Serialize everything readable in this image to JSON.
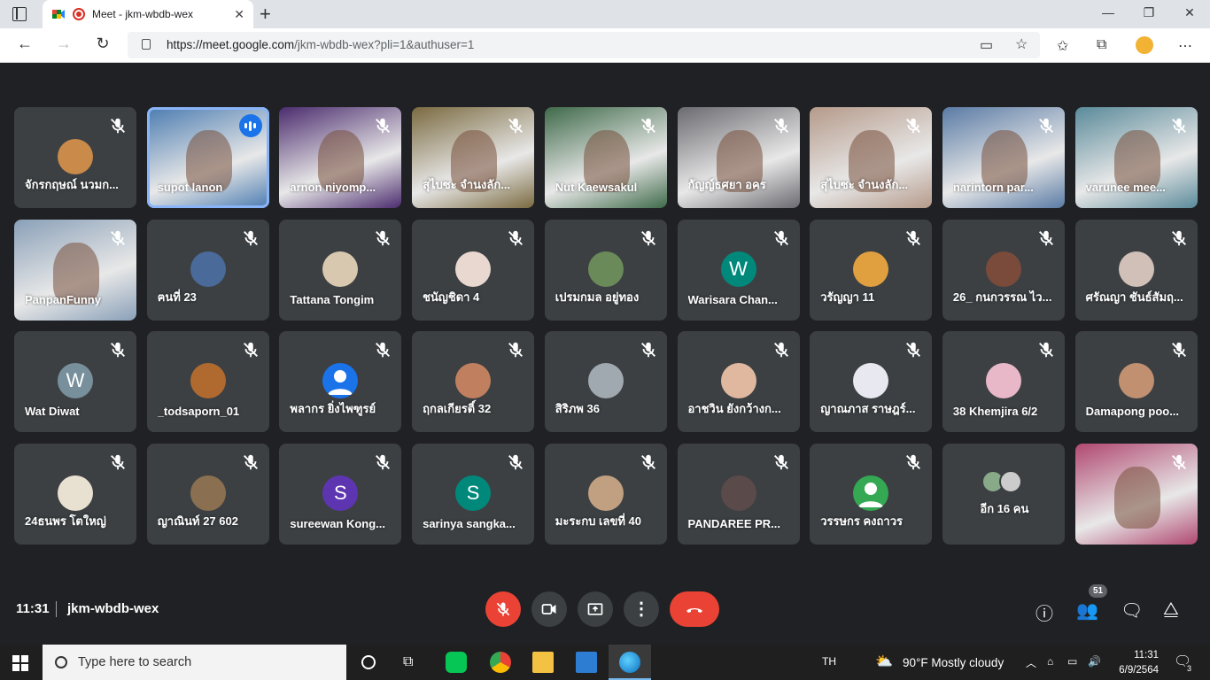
{
  "browser": {
    "tab_title": "Meet - jkm-wbdb-wex",
    "url_host": "https://meet.google.com",
    "url_path": "/jkm-wbdb-wex?pli=1&authuser=1"
  },
  "participants": [
    {
      "name": "จักรกฤษณ์ นวมก...",
      "kind": "avatar",
      "color": "#c98a4a",
      "muted": true
    },
    {
      "name": "supot lanon",
      "kind": "video",
      "color": "#4a7bb0",
      "speaking": true
    },
    {
      "name": "arnon niyomp...",
      "kind": "video",
      "color": "#4b2c6e",
      "muted": true
    },
    {
      "name": "สุไบซะ จำนงลัก...",
      "kind": "video",
      "color": "#7a6a40",
      "muted": true
    },
    {
      "name": "Nut Kaewsakul",
      "kind": "video",
      "color": "#3f6a4a",
      "muted": true
    },
    {
      "name": "กัญญ์ธศยา อคร",
      "kind": "video",
      "color": "#6a6a70",
      "muted": true
    },
    {
      "name": "สุไบซะ จำนงลัก...",
      "kind": "video",
      "color": "#b59a8a",
      "muted": true
    },
    {
      "name": "narintorn par...",
      "kind": "video",
      "color": "#5a7ba5",
      "muted": true
    },
    {
      "name": "varunee mee...",
      "kind": "video",
      "color": "#5a8a9a",
      "muted": true
    },
    {
      "name": "PanpanFunny",
      "kind": "video",
      "color": "#8aa0b8",
      "muted": true
    },
    {
      "name": "ฅนที่ 23",
      "kind": "avatar",
      "color": "#4a6a9a",
      "muted": true
    },
    {
      "name": "Tattana Tongim",
      "kind": "avatar",
      "color": "#d8c8b0",
      "muted": true
    },
    {
      "name": "ชนัญชิดา 4",
      "kind": "avatar",
      "color": "#e8d8d0",
      "muted": true
    },
    {
      "name": "เปรมกมล อยู่ทอง",
      "kind": "avatar",
      "color": "#6a8a5a",
      "muted": true
    },
    {
      "name": "Warisara Chan...",
      "kind": "letter",
      "letter": "W",
      "color": "#00897b",
      "muted": true
    },
    {
      "name": "วรัญญา 11",
      "kind": "avatar",
      "color": "#e0a040",
      "muted": true
    },
    {
      "name": "26_ กนกวรรณ ไว...",
      "kind": "avatar",
      "color": "#7a4a3a",
      "muted": true
    },
    {
      "name": "ศรัณญา ชันธ์สัมฤ...",
      "kind": "avatar",
      "color": "#d0c0b8",
      "muted": true
    },
    {
      "name": "Wat Diwat",
      "kind": "letter",
      "letter": "W",
      "color": "#78909c",
      "muted": true
    },
    {
      "name": "_todsaporn_01",
      "kind": "avatar",
      "color": "#b06a30",
      "muted": true
    },
    {
      "name": "พลากร ยิ่งไพฑูรย์",
      "kind": "person",
      "color": "#1a73e8",
      "muted": true
    },
    {
      "name": "ฤกลเกียรติ์ 32",
      "kind": "avatar",
      "color": "#c08060",
      "muted": true
    },
    {
      "name": "สิริภพ 36",
      "kind": "avatar",
      "color": "#a0a8b0",
      "muted": true
    },
    {
      "name": "อาชวิน ยังกว้างก...",
      "kind": "avatar",
      "color": "#e0b8a0",
      "muted": true
    },
    {
      "name": "ญาณภาส ราษฎร์...",
      "kind": "avatar",
      "color": "#e8e8f0",
      "muted": true
    },
    {
      "name": "38 Khemjira 6/2",
      "kind": "avatar",
      "color": "#e8b8c8",
      "muted": true
    },
    {
      "name": "Damapong poo...",
      "kind": "avatar",
      "color": "#c09070",
      "muted": true
    },
    {
      "name": "24ธนพร โตใหญ่",
      "kind": "avatar",
      "color": "#e8e0d0",
      "muted": true
    },
    {
      "name": "ญาณินท์ 27 602",
      "kind": "avatar",
      "color": "#8a7050",
      "muted": true
    },
    {
      "name": "sureewan Kong...",
      "kind": "letter",
      "letter": "S",
      "color": "#5e35b1",
      "muted": true
    },
    {
      "name": "sarinya sangka...",
      "kind": "letter",
      "letter": "S",
      "color": "#00897b",
      "muted": true
    },
    {
      "name": "มะระกบ เลขที่ 40",
      "kind": "avatar",
      "color": "#c0a080",
      "muted": true
    },
    {
      "name": "PANDAREE PR...",
      "kind": "avatar",
      "color": "#5a4a4a",
      "muted": true
    },
    {
      "name": "วรรษกร คงถาวร",
      "kind": "person",
      "color": "#34a853",
      "muted": true
    },
    {
      "name": "อีก 16 คน",
      "kind": "more"
    },
    {
      "name": "",
      "kind": "self",
      "color": "#b04870",
      "muted": true
    }
  ],
  "bottom": {
    "time": "11:31",
    "meeting_code": "jkm-wbdb-wex",
    "people_count": "51"
  },
  "taskbar": {
    "search_placeholder": "Type here to search",
    "lang": "TH",
    "weather": "90°F  Mostly cloudy",
    "time": "11:31",
    "date": "6/9/2564",
    "notif_count": "3"
  }
}
